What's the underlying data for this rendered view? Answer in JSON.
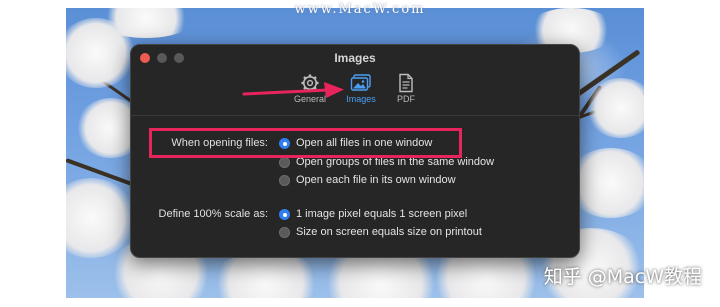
{
  "watermark": {
    "top": "www.MacW.com",
    "bottom": "知乎 @MacW教程"
  },
  "window": {
    "title": "Images"
  },
  "toolbar": {
    "tabs": [
      {
        "label": "General",
        "icon": "gear-icon"
      },
      {
        "label": "Images",
        "icon": "images-icon",
        "selected": true
      },
      {
        "label": "PDF",
        "icon": "pdf-document-icon"
      }
    ]
  },
  "opening_files": {
    "label": "When opening files:",
    "options": [
      {
        "label": "Open all files in one window",
        "selected": true
      },
      {
        "label": "Open groups of files in the same window",
        "selected": false
      },
      {
        "label": "Open each file in its own window",
        "selected": false
      }
    ]
  },
  "scale": {
    "label": "Define 100% scale as:",
    "options": [
      {
        "label": "1 image pixel equals 1 screen pixel",
        "selected": true
      },
      {
        "label": "Size on screen equals size on printout",
        "selected": false
      }
    ]
  },
  "colors": {
    "accent": "#2f7ff0",
    "highlight": "#e8245c",
    "window_bg": "#262626"
  }
}
